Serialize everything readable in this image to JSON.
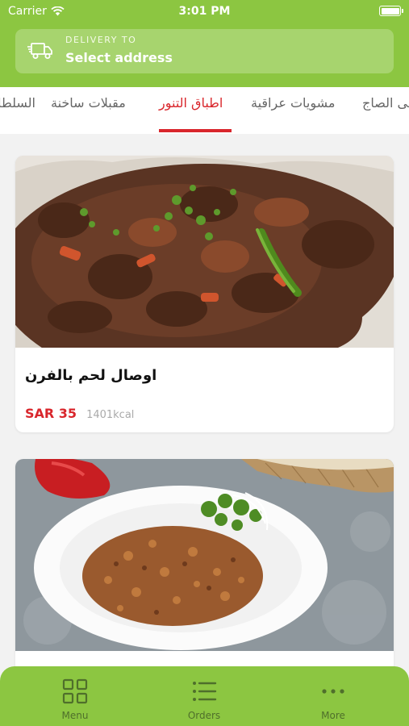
{
  "status_bar": {
    "carrier": "Carrier",
    "time": "3:01 PM"
  },
  "delivery": {
    "label": "DELIVERY TO",
    "value": "Select address"
  },
  "tabs": [
    {
      "label": "السلطات",
      "active": false
    },
    {
      "label": "مقبلات ساخنة",
      "active": false
    },
    {
      "label": "اطباق التنور",
      "active": true
    },
    {
      "label": "مشويات عراقية",
      "active": false
    },
    {
      "label": "على الصاج",
      "active": false
    }
  ],
  "items": [
    {
      "name": "اوصال لحم بالفرن",
      "price": "SAR 35",
      "kcal": "1401kcal"
    },
    {
      "name": "",
      "price": "",
      "kcal": ""
    }
  ],
  "bottom_nav": [
    {
      "label": "Menu",
      "icon": "grid-icon"
    },
    {
      "label": "Orders",
      "icon": "list-icon"
    },
    {
      "label": "More",
      "icon": "more-dots-icon"
    }
  ],
  "colors": {
    "brand_green": "#8cc641",
    "accent_red": "#d9262c"
  }
}
